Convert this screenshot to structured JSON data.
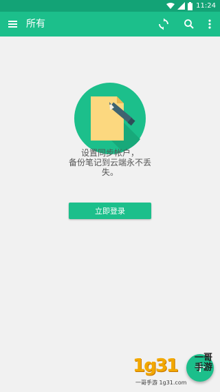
{
  "status_bar": {
    "time": "11:24",
    "icons": [
      "wifi-icon",
      "signal-icon",
      "battery-icon"
    ]
  },
  "app_bar": {
    "title": "所有",
    "left_icon": "menu-icon",
    "actions": [
      "sync-icon",
      "search-icon",
      "more-vert-icon"
    ]
  },
  "empty_state": {
    "illustration": "note-pencil-icon",
    "message_line1": "设置同步帐户，",
    "message_line2": "备份笔记到云端永不丢",
    "message_line3": "失。",
    "button_label": "立即登录"
  },
  "fab": {
    "icon": "add-icon",
    "label": "+"
  },
  "watermark": {
    "digits": "1g31",
    "brand": "一哥手游",
    "sub": "一哥手游 1g31.com"
  },
  "colors": {
    "accent": "#1cbf8b",
    "status_bar": "#13a376",
    "background": "#f1f1f1",
    "note": "#fcd87f"
  }
}
